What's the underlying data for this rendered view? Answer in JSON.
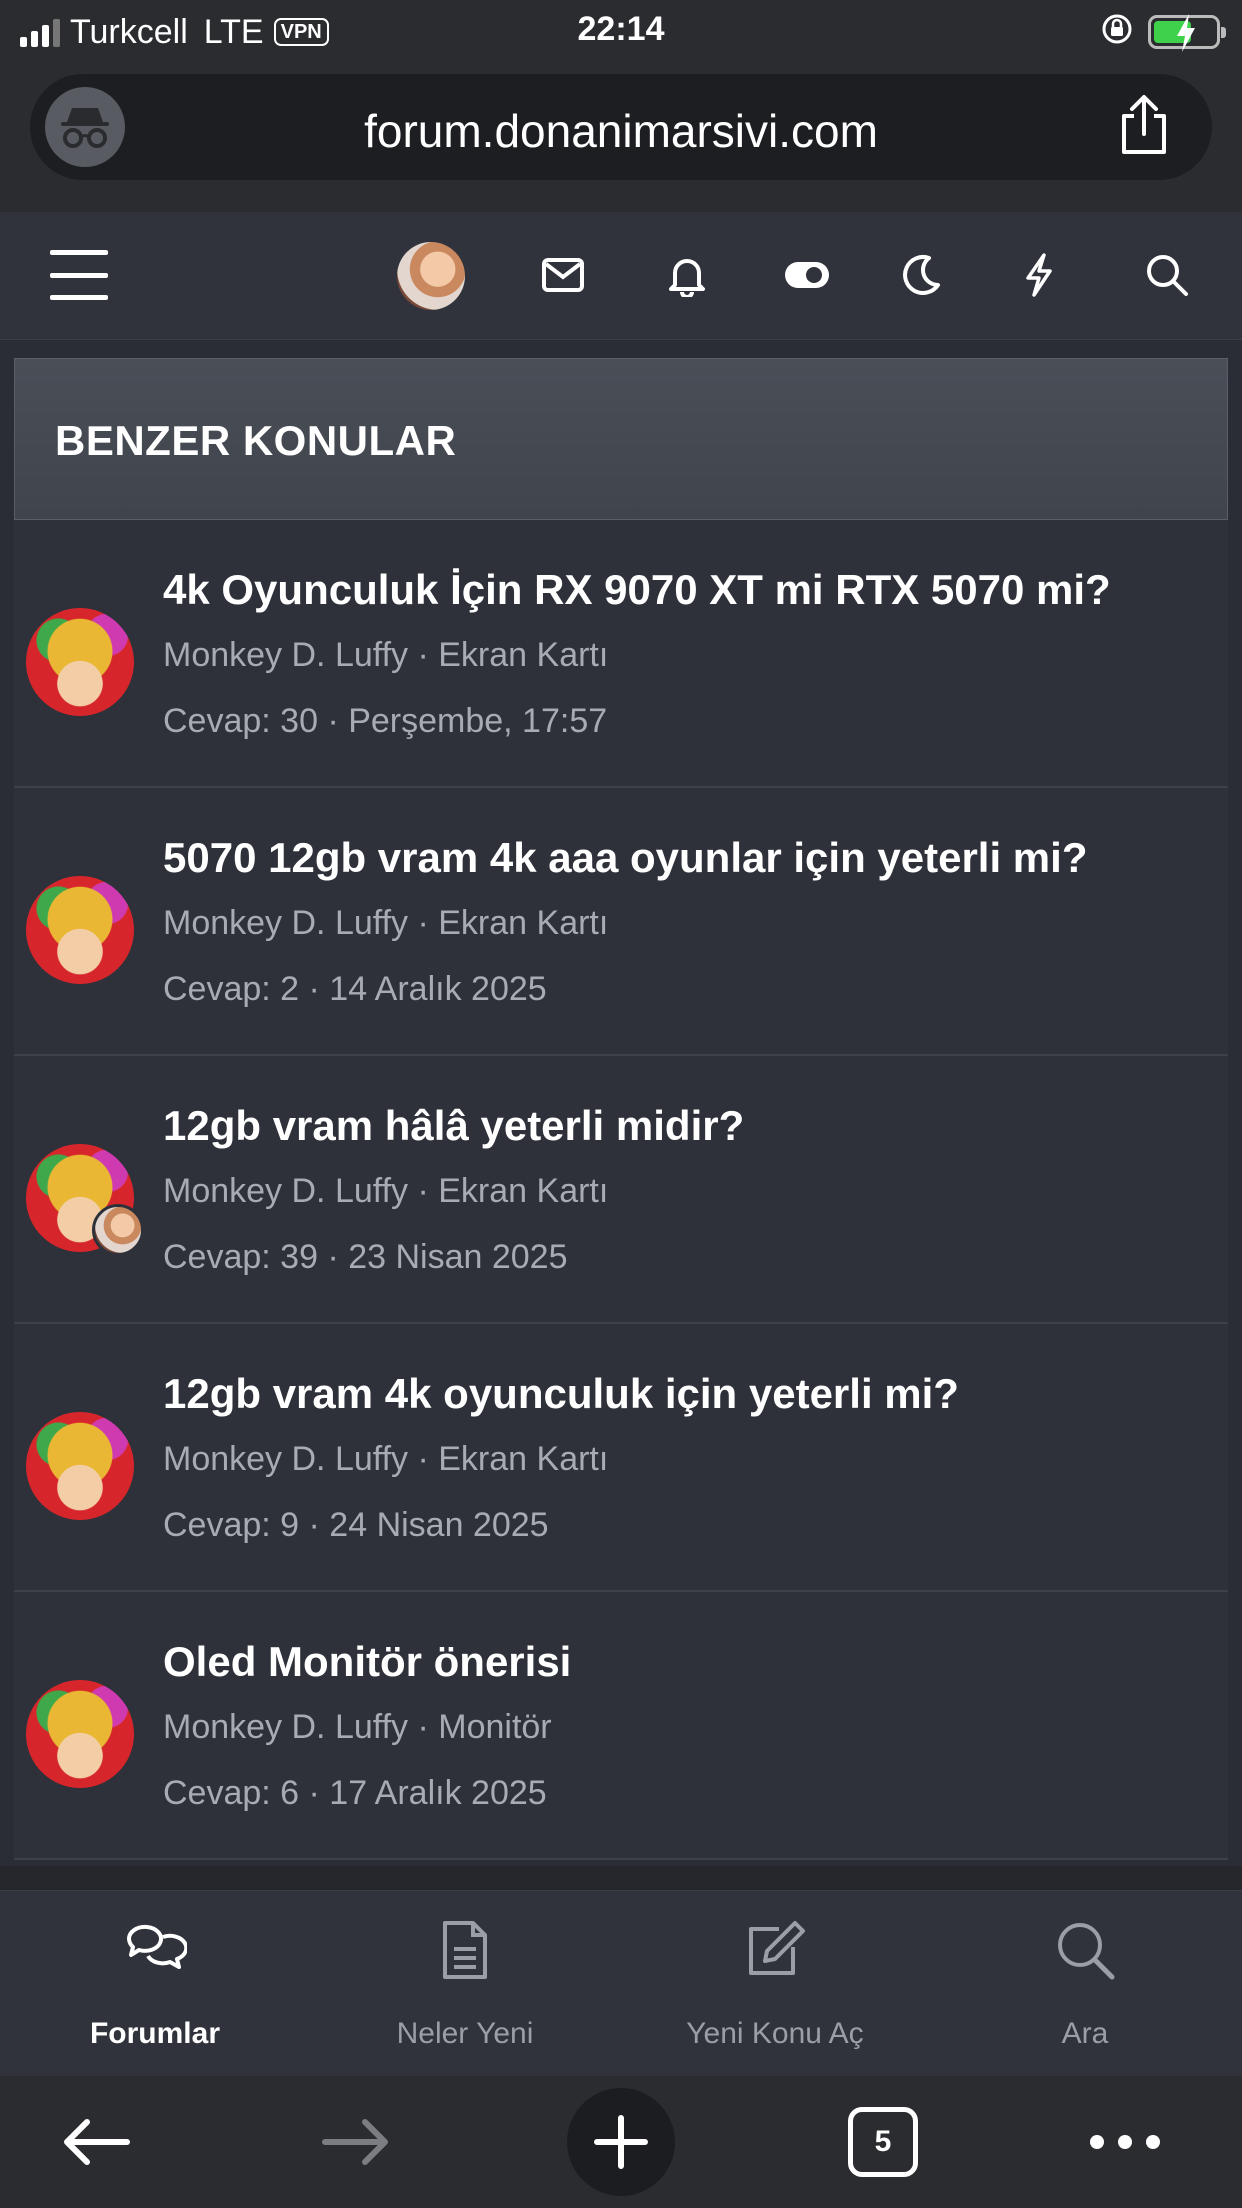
{
  "status_bar": {
    "carrier": "Turkcell",
    "network": "LTE",
    "vpn": "VPN",
    "time": "22:14"
  },
  "browser": {
    "url": "forum.donanimarsivi.com",
    "tabs_count": "5"
  },
  "section": {
    "title": "BENZER KONULAR"
  },
  "threads": [
    {
      "title": "4k Oyunculuk İçin RX 9070 XT mi RTX 5070 mi?",
      "meta": "Monkey D. Luffy · Ekran Kartı",
      "stats": "Cevap: 30 · Perşembe, 17:57"
    },
    {
      "title": "5070 12gb vram 4k aaa oyunlar için yeterli mi?",
      "meta": "Monkey D. Luffy · Ekran Kartı",
      "stats": "Cevap: 2 · 14 Aralık 2025"
    },
    {
      "title": "12gb vram hâlâ yeterli midir?",
      "meta": "Monkey D. Luffy · Ekran Kartı",
      "stats": "Cevap: 39 · 23 Nisan 2025"
    },
    {
      "title": "12gb vram 4k oyunculuk için yeterli mi?",
      "meta": "Monkey D. Luffy · Ekran Kartı",
      "stats": "Cevap: 9 · 24 Nisan 2025"
    },
    {
      "title": "Oled Monitör önerisi",
      "meta": "Monkey D. Luffy · Monitör",
      "stats": "Cevap: 6 · 17 Aralık 2025"
    }
  ],
  "tabnav": {
    "forums": "Forumlar",
    "whats_new": "Neler Yeni",
    "new_thread": "Yeni Konu Aç",
    "search": "Ara"
  },
  "icons": {
    "header": [
      "hamburger-menu-icon",
      "avatar",
      "envelope-icon",
      "bell-icon",
      "toggle-icon",
      "moon-icon",
      "bolt-icon",
      "search-icon"
    ],
    "toolbar": [
      "back-arrow-icon",
      "forward-arrow-icon",
      "plus-icon",
      "tabs-icon",
      "more-icon"
    ]
  },
  "colors": {
    "background": "#2a2d36",
    "row": "#2e313a",
    "meta_text": "#a8abb2",
    "battery": "#3fd14c"
  }
}
